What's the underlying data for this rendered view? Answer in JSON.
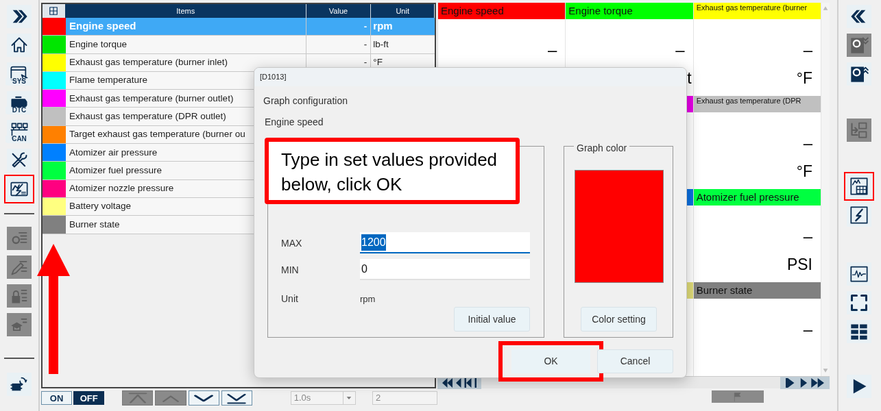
{
  "left_toolbar": {
    "top": [
      {
        "disabled": false,
        "highlighted": false
      },
      {
        "disabled": false,
        "highlighted": false
      },
      {
        "disabled": false,
        "highlighted": false,
        "badge": "SYS"
      },
      {
        "disabled": false,
        "highlighted": false,
        "badge": "DTC"
      },
      {
        "disabled": false,
        "highlighted": false,
        "badge": "CAN"
      },
      {
        "disabled": false,
        "highlighted": false
      },
      {
        "disabled": false,
        "highlighted": true
      }
    ],
    "middle": [
      {
        "disabled": true,
        "highlighted": false
      },
      {
        "disabled": true,
        "highlighted": false
      },
      {
        "disabled": true,
        "highlighted": false
      },
      {
        "disabled": true,
        "highlighted": false
      }
    ],
    "bottom": [
      {
        "disabled": false,
        "highlighted": false
      }
    ]
  },
  "table": {
    "columns": [
      "Items",
      "Value",
      "Unit"
    ],
    "rows": [
      {
        "color": "#ff0000",
        "label": "Engine speed",
        "value": "-",
        "unit": "rpm",
        "selected": true
      },
      {
        "color": "#00e600",
        "label": "Engine torque",
        "value": "-",
        "unit": "lb-ft",
        "selected": false
      },
      {
        "color": "#ffff00",
        "label": "Exhaust gas temperature (burner inlet)",
        "value": "-",
        "unit": "°F",
        "selected": false
      },
      {
        "color": "#00ffff",
        "label": "Flame temperature",
        "selected": false
      },
      {
        "color": "#ff00ff",
        "label": "Exhaust gas temperature (burner outlet)",
        "selected": false
      },
      {
        "color": "#c0c0c0",
        "label": "Exhaust gas temperature (DPR outlet)",
        "selected": false
      },
      {
        "color": "#ff8000",
        "label": "Target exhaust gas temperature (burner ou",
        "selected": false
      },
      {
        "color": "#0080ff",
        "label": "Atomizer air pressure",
        "selected": false
      },
      {
        "color": "#00ff40",
        "label": "Atomizer fuel pressure",
        "selected": false
      },
      {
        "color": "#ff0080",
        "label": "Atomizer nozzle pressure",
        "selected": false
      },
      {
        "color": "#ffff80",
        "label": "Battery voltage",
        "selected": false
      },
      {
        "color": "#808080",
        "label": "Burner state",
        "selected": false
      }
    ]
  },
  "bottom_bar": {
    "toggle": [
      {
        "label": "ON",
        "selected": false
      },
      {
        "label": "OFF",
        "selected": true
      }
    ],
    "scroll_buttons": [
      {
        "disabled": true
      },
      {
        "disabled": true
      },
      {
        "disabled": false
      },
      {
        "disabled": false
      }
    ],
    "interval": "1.0s",
    "count": "2"
  },
  "monitor": {
    "columns": [
      [
        {
          "color": "#ff0000",
          "title": "Engine speed",
          "value": "–"
        }
      ],
      [
        {
          "color": "#00ff00",
          "title": "Engine torque",
          "value": "–",
          "unit": "t"
        },
        {
          "color": "#e600e6"
        },
        {
          "color": "#0a70e0"
        },
        {
          "color": "#e0dc78"
        }
      ],
      [
        {
          "color": "#ffff00",
          "title": "Exhaust gas temperature (burner",
          "small": true,
          "value": "–",
          "unit": "°F"
        },
        {
          "color": "#c0c0c0",
          "title": "Exhaust gas temperature (DPR",
          "small": true,
          "value": "–",
          "unit": "°F"
        },
        {
          "color": "#00ff40",
          "title": "Atomizer fuel pressure",
          "value": "–",
          "unit": "PSI"
        },
        {
          "color": "#808080",
          "title": "Burner state",
          "value": "–"
        }
      ]
    ]
  },
  "right_toolbar": {
    "groups": [
      [
        {
          "disabled": false,
          "highlighted": false
        },
        {
          "disabled": true,
          "highlighted": false
        },
        {
          "disabled": false,
          "highlighted": false
        }
      ],
      [
        {
          "disabled": true,
          "highlighted": false
        }
      ],
      [
        {
          "disabled": false,
          "highlighted": true
        },
        {
          "disabled": false,
          "highlighted": false
        }
      ],
      [
        {
          "disabled": false,
          "highlighted": false
        },
        {
          "disabled": false,
          "highlighted": false
        },
        {
          "disabled": false,
          "highlighted": false
        }
      ],
      [
        {
          "disabled": false,
          "highlighted": false
        }
      ]
    ]
  },
  "dialog": {
    "title": "[D1013]",
    "heading": "Graph configuration",
    "item": "Engine speed",
    "fields": [
      {
        "label": "MAX",
        "value": "1200",
        "focused": true
      },
      {
        "label": "MIN",
        "value": "0",
        "focused": false
      }
    ],
    "unit_label": "Unit",
    "unit": "rpm",
    "initial_button": "Initial value",
    "color_group": "Graph color",
    "color": "#ff0000",
    "color_button": "Color setting",
    "buttons": [
      {
        "label": "OK",
        "highlighted": true
      },
      {
        "label": "Cancel",
        "highlighted": false
      }
    ]
  },
  "annotation": {
    "callout": "Type in set values provided below, click OK"
  }
}
